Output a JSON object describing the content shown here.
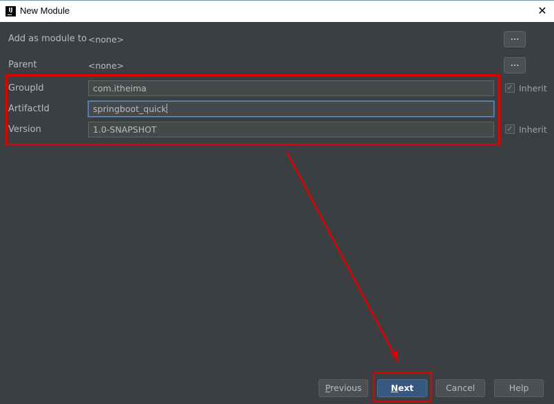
{
  "window": {
    "title": "New Module",
    "close_glyph": "✕",
    "app_icon_text": "IJ"
  },
  "form": {
    "add_as_module_to": {
      "label": "Add as module to",
      "value": "<none>"
    },
    "parent": {
      "label": "Parent",
      "value": "<none>"
    },
    "browse_label": "...",
    "group_id": {
      "label": "GroupId",
      "value": "com.itheima",
      "inherit": true
    },
    "artifact_id": {
      "label": "ArtifactId",
      "value": "springboot_quick"
    },
    "version": {
      "label": "Version",
      "value": "1.0-SNAPSHOT",
      "inherit": true
    },
    "inherit_label": "Inherit"
  },
  "buttons": {
    "previous_first": "P",
    "previous_rest": "revious",
    "next_first": "N",
    "next_rest": "ext",
    "cancel": "Cancel",
    "help": "Help"
  },
  "colors": {
    "dialog_bg": "#3c3f41",
    "annotation_red": "#e00000",
    "default_button": "#365880"
  }
}
